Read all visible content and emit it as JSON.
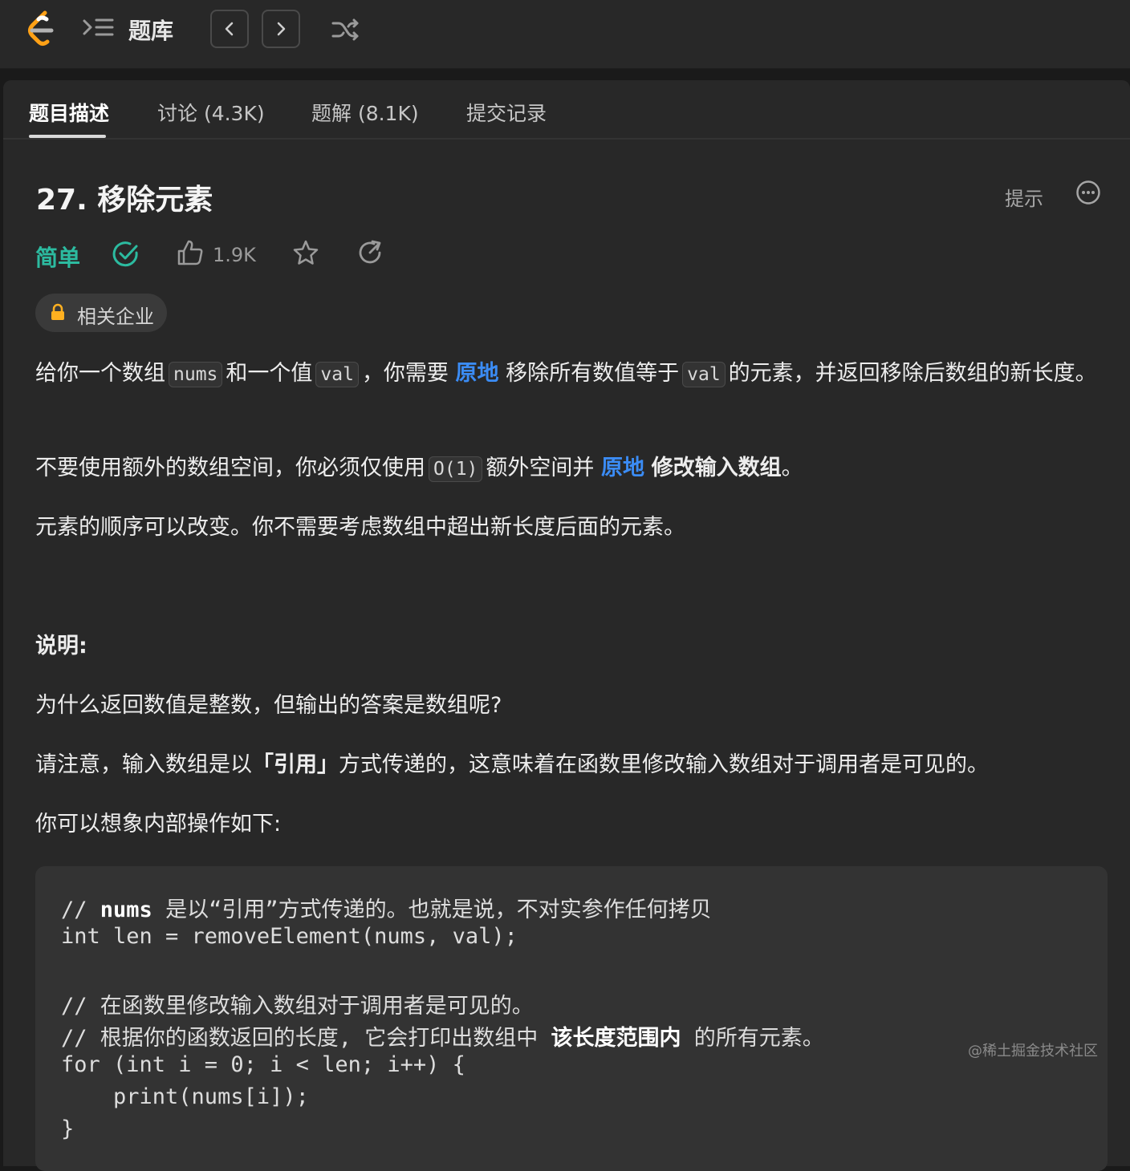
{
  "topbar": {
    "logo_icon": "leetcode-logo-icon",
    "problem_list_label": "题库",
    "prev_icon": "chevron-left-icon",
    "next_icon": "chevron-right-icon",
    "shuffle_icon": "shuffle-icon"
  },
  "tabs": [
    {
      "label": "题目描述",
      "active": true
    },
    {
      "label": "讨论 (4.3K)",
      "active": false
    },
    {
      "label": "题解 (8.1K)",
      "active": false
    },
    {
      "label": "提交记录",
      "active": false
    }
  ],
  "problem": {
    "title": "27. 移除元素",
    "hint_label": "提示",
    "difficulty": "简单",
    "likes": "1.9K",
    "company_tag": "相关企业"
  },
  "description": {
    "p1_a": "给你一个数组",
    "p1_code1": "nums",
    "p1_b": "和一个值",
    "p1_code2": "val",
    "p1_c": "，你需要",
    "p1_link": "原地",
    "p1_d": "移除所有数值等于",
    "p1_code3": "val",
    "p1_e": "的元素，并返回移除后数组的新长度。",
    "p2_a": "不要使用额外的数组空间，你必须仅使用",
    "p2_code": "O(1)",
    "p2_b": "额外空间并",
    "p2_link": "原地",
    "p2_bold": "修改输入数组",
    "p2_c": "。",
    "p3": "元素的顺序可以改变。你不需要考虑数组中超出新长度后面的元素。",
    "p4": "说明:",
    "p5": "为什么返回数值是整数，但输出的答案是数组呢?",
    "p6_a": "请注意，输入数组是以",
    "p6_bold": "「引用」",
    "p6_b": "方式传递的，这意味着在函数里修改输入数组对于调用者是可见的。",
    "p7": "你可以想象内部操作如下:"
  },
  "code": {
    "l1_a": "// ",
    "l1_bold": "nums",
    "l1_b": " 是以“引用”方式传递的。也就是说，不对实参作任何拷贝",
    "l2": "int len = removeElement(nums, val);",
    "l3": "// 在函数里修改输入数组对于调用者是可见的。",
    "l4_a": "// 根据你的函数返回的长度, 它会打印出数组中 ",
    "l4_bold": "该长度范围内",
    "l4_b": " 的所有元素。",
    "l5": "for (int i = 0; i < len; i++) {",
    "l6": "    print(nums[i]);",
    "l7": "}"
  },
  "watermark": "@稀土掘金技术社区",
  "colors": {
    "background": "#1a1a1a",
    "panel": "#282828",
    "difficulty_easy": "#2cbba0",
    "link_blue": "#3b8cf5"
  }
}
